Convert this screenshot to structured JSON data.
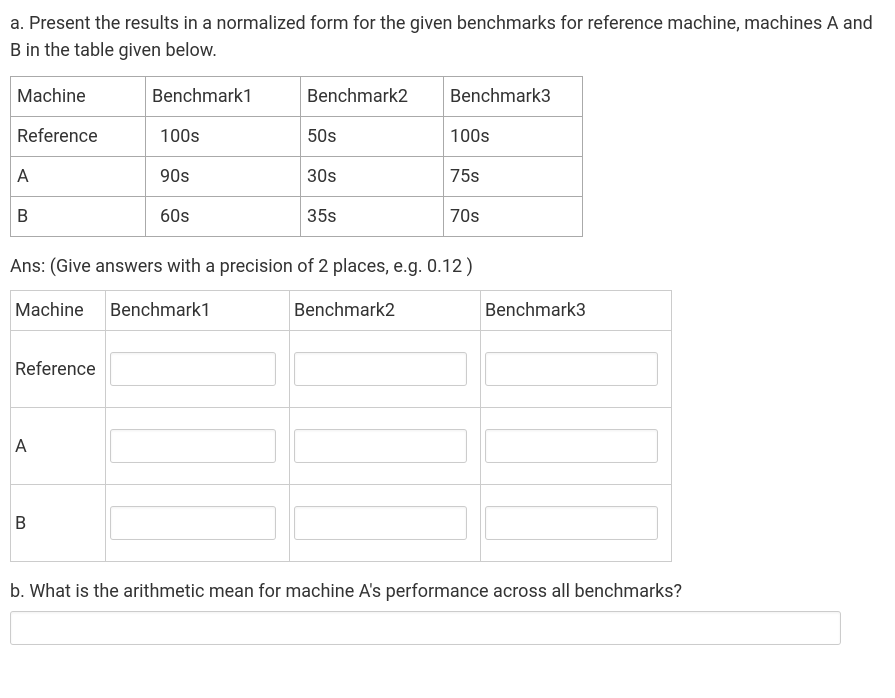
{
  "question_a": "a. Present the results in a normalized form for the given benchmarks for reference machine, machines A and B in the table given below.",
  "data_table": {
    "headers": [
      "Machine",
      "Benchmark1",
      "Benchmark2",
      "Benchmark3"
    ],
    "rows": [
      [
        "Reference",
        "100s",
        "50s",
        "100s"
      ],
      [
        "A",
        "90s",
        "30s",
        "75s"
      ],
      [
        "B",
        "60s",
        "35s",
        "70s"
      ]
    ]
  },
  "ans_prompt": "Ans: (Give answers with a precision of 2 places, e.g. 0.12 )",
  "answer_table": {
    "headers": [
      "Machine",
      "Benchmark1",
      "Benchmark2",
      "Benchmark3"
    ],
    "row_labels": [
      "Reference",
      "A",
      "B"
    ]
  },
  "question_b": "b. What is the arithmetic mean for machine A's  performance across all benchmarks?"
}
